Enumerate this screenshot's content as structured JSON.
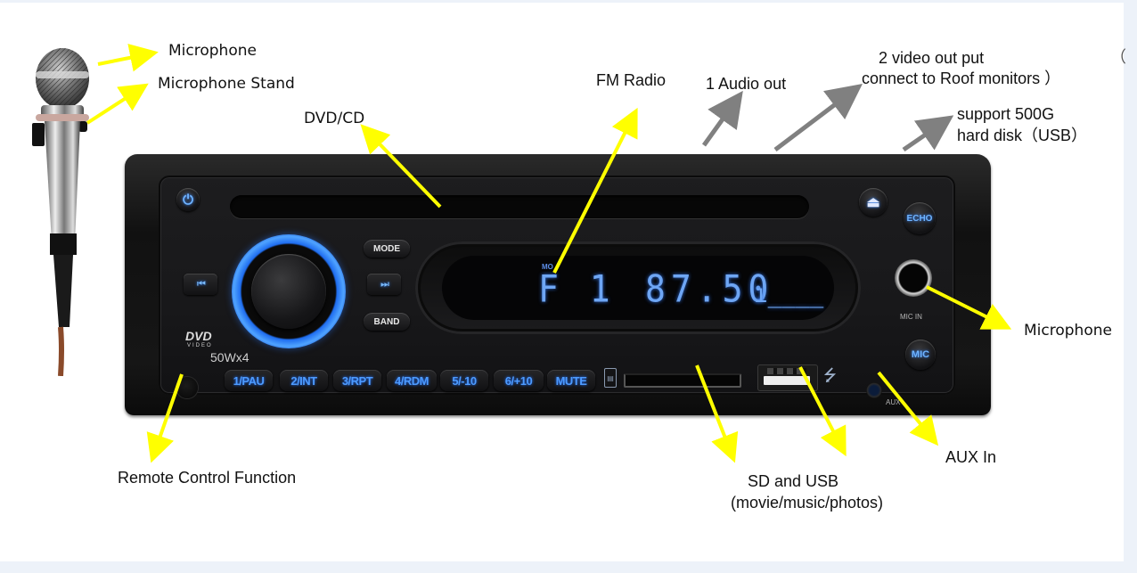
{
  "labels": {
    "microphone_top": "Microphone",
    "microphone_stand": "Microphone Stand",
    "dvd_cd": "DVD/CD",
    "fm_radio": "FM Radio",
    "audio_out": "1 Audio out",
    "video_out_line1": "2 video out put",
    "video_out_line2": "connect to Roof monitors ）",
    "stray_paren": "（",
    "usb_hdd_line1": "support 500G",
    "usb_hdd_line2": "hard disk（USB）",
    "microphone_right": "Microphone",
    "remote_control": "Remote Control Function",
    "sd_usb_line1": "SD and USB",
    "sd_usb_line2": "(movie/music/photos)",
    "aux_in": "AUX In"
  },
  "device": {
    "power_icon": "power-icon",
    "eject_icon": "eject-icon",
    "echo_label": "ECHO",
    "mode_label": "MODE",
    "band_label": "BAND",
    "prev_icon": "previous-track-icon",
    "next_icon": "next-track-icon",
    "prev_glyph": "⏮",
    "next_glyph": "⏭",
    "power_glyph": "⏻",
    "eject_glyph": "⏏",
    "usb_glyph": "⭍",
    "dvd_logo": "DVD",
    "dvd_sub": "VIDEO",
    "power_rating": "50Wx4",
    "mic_in_label": "MIC IN",
    "mic_button_label": "MIC",
    "aux_label": "AUX",
    "display": {
      "indicator": "MO",
      "preset": "F 1",
      "frequency": "87.50",
      "tail": "ı____"
    },
    "number_buttons": [
      "1/PAU",
      "2/INT",
      "3/RPT",
      "4/RDM",
      "5/-10",
      "6/+10",
      "MUTE"
    ]
  },
  "colors": {
    "accent_blue": "#4d9bff",
    "arrow_yellow": "#ffff00",
    "arrow_gray": "#808080",
    "background": "#ffffff",
    "page_frame": "#edf2f9"
  }
}
